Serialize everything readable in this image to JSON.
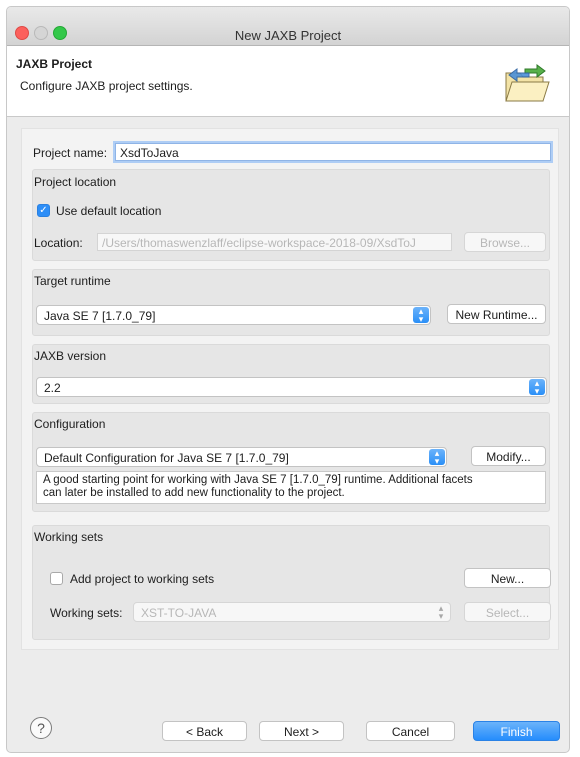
{
  "window": {
    "title": "New JAXB Project",
    "traffic_lights": [
      "close",
      "minimize",
      "zoom"
    ]
  },
  "banner": {
    "title": "JAXB Project",
    "description": "Configure JAXB project settings.",
    "icon": "wizard-folder-icon"
  },
  "project_name": {
    "label": "Project name:",
    "value": "XsdToJava"
  },
  "project_location": {
    "section_label": "Project location",
    "use_default_label": "Use default location",
    "use_default_checked": true,
    "location_label": "Location:",
    "location_value": "/Users/thomaswenzlaff/eclipse-workspace-2018-09/XsdToJ",
    "browse_label": "Browse..."
  },
  "target_runtime": {
    "section_label": "Target runtime",
    "selected": "Java SE 7 [1.7.0_79]",
    "new_runtime_label": "New Runtime..."
  },
  "jaxb_version": {
    "section_label": "JAXB version",
    "selected": "2.2"
  },
  "configuration": {
    "section_label": "Configuration",
    "selected": "Default Configuration for Java SE 7 [1.7.0_79]",
    "modify_label": "Modify...",
    "description_line1": "A good starting point for working with Java SE 7 [1.7.0_79] runtime. Additional facets",
    "description_line2": "can later be installed to add new functionality to the project."
  },
  "working_sets": {
    "section_label": "Working sets",
    "add_label": "Add project to working sets",
    "add_checked": false,
    "new_label": "New...",
    "sets_label": "Working sets:",
    "sets_value": "XST-TO-JAVA",
    "select_label": "Select..."
  },
  "footer": {
    "help_glyph": "?",
    "back_label": "< Back",
    "next_label": "Next >",
    "cancel_label": "Cancel",
    "finish_label": "Finish"
  },
  "colors": {
    "accent": "#258dfc",
    "window_bg": "#ececec",
    "close": "#fc605c",
    "zoom": "#34c84a"
  }
}
